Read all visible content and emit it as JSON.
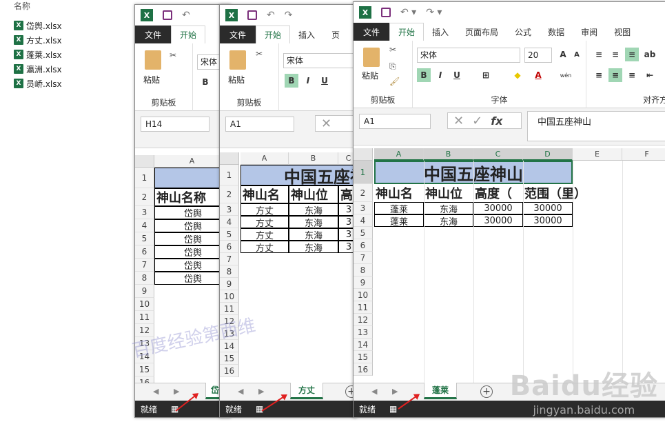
{
  "explorer": {
    "header": "名称",
    "files": [
      "岱舆.xlsx",
      "方丈.xlsx",
      "蓬莱.xlsx",
      "瀛洲.xlsx",
      "员峤.xlsx"
    ]
  },
  "ribbon_tabs": [
    "文件",
    "开始",
    "插入",
    "页面布局",
    "公式",
    "数据",
    "审阅",
    "视图"
  ],
  "ribbon": {
    "paste": "粘贴",
    "clipboard": "剪贴板",
    "font_group": "字体",
    "align_group": "对齐方",
    "font_name": "宋体",
    "font_size": "20",
    "bold": "B",
    "italic": "I",
    "underline": "U",
    "wen": "wén"
  },
  "windows": {
    "w1": {
      "namebox": "H14",
      "sheet": "岱舆",
      "status": "就绪"
    },
    "w2": {
      "namebox": "A1",
      "sheet": "方丈",
      "status": "就绪"
    },
    "w3": {
      "namebox": "A1",
      "sheet": "蓬莱",
      "status": "就绪",
      "formula": "中国五座神山"
    }
  },
  "table": {
    "title": "中国五座神山",
    "headers": [
      "神山名称",
      "神山位置",
      "高度（米）",
      "范围（里）"
    ],
    "w1_headers": [
      "神山名称"
    ],
    "w2_headers": [
      "神山名",
      "神山位",
      "高"
    ],
    "w3_headers": [
      "神山名",
      "神山位",
      "高度（",
      "范围（里）"
    ],
    "w1_rows": [
      "岱舆",
      "岱舆",
      "岱舆",
      "岱舆",
      "岱舆",
      "岱舆"
    ],
    "w2_rows": [
      [
        "方丈",
        "东海",
        "3"
      ],
      [
        "方丈",
        "东海",
        "3"
      ],
      [
        "方丈",
        "东海",
        "3"
      ],
      [
        "方丈",
        "东海",
        "3"
      ]
    ],
    "w3_rows": [
      [
        "蓬莱",
        "东海",
        "30000",
        "30000"
      ],
      [
        "蓬莱",
        "东海",
        "30000",
        "30000"
      ]
    ]
  },
  "columns": [
    "A",
    "B",
    "C",
    "D",
    "E",
    "F"
  ],
  "rows": [
    "1",
    "2",
    "3",
    "4",
    "5",
    "6",
    "7",
    "8",
    "9",
    "10",
    "11",
    "12",
    "13",
    "14",
    "15",
    "16"
  ],
  "watermark": {
    "text": "百度经验第西维",
    "baidu": "Baidu经验",
    "url": "jingyan.baidu.com"
  }
}
